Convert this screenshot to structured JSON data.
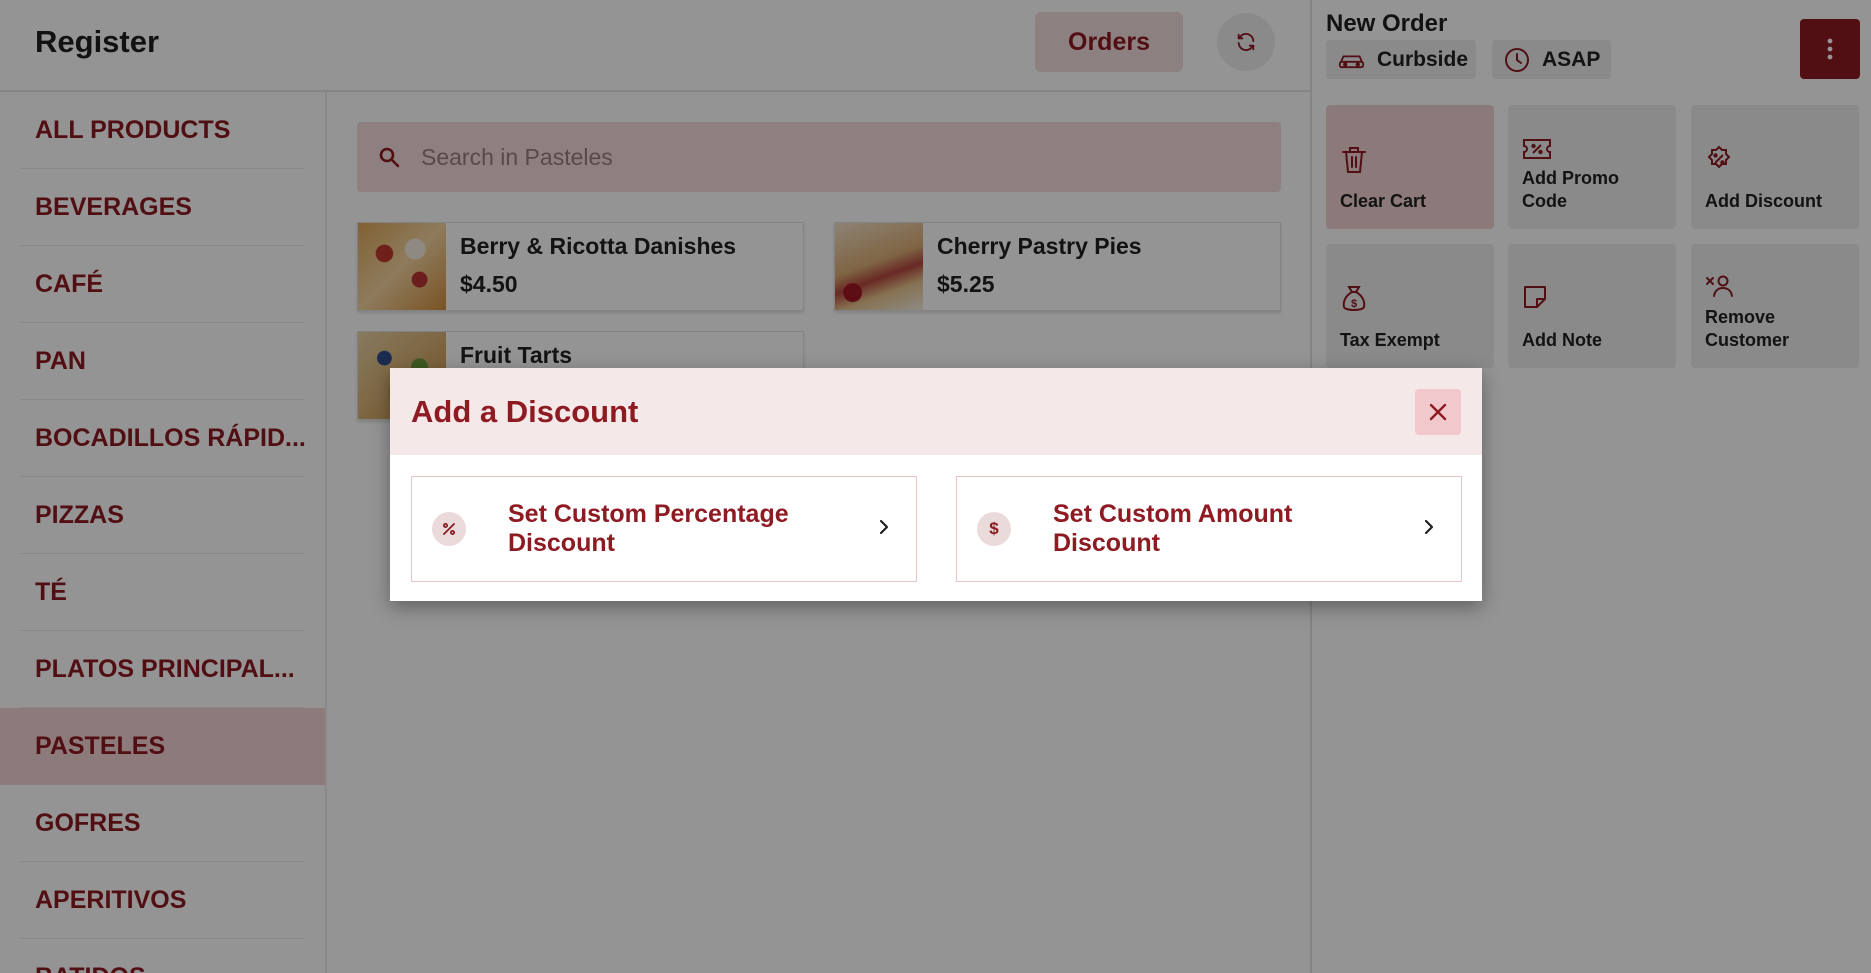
{
  "header": {
    "title": "Register",
    "orders_label": "Orders"
  },
  "categories": [
    {
      "label": "ALL PRODUCTS",
      "active": false
    },
    {
      "label": "BEVERAGES",
      "active": false
    },
    {
      "label": "CAFÉ",
      "active": false
    },
    {
      "label": "PAN",
      "active": false
    },
    {
      "label": "BOCADILLOS RÁPID...",
      "active": false
    },
    {
      "label": "PIZZAS",
      "active": false
    },
    {
      "label": "TÉ",
      "active": false
    },
    {
      "label": "PLATOS PRINCIPAL...",
      "active": false
    },
    {
      "label": "PASTELES",
      "active": true
    },
    {
      "label": "GOFRES",
      "active": false
    },
    {
      "label": "APERITIVOS",
      "active": false
    },
    {
      "label": "BATIDOS",
      "active": false
    }
  ],
  "search": {
    "placeholder": "Search in Pasteles",
    "value": ""
  },
  "products": [
    {
      "name": "Berry & Ricotta Danishes",
      "price": "$4.50"
    },
    {
      "name": "Cherry Pastry Pies",
      "price": "$5.25"
    },
    {
      "name": "Fruit Tarts",
      "price": ""
    }
  ],
  "order": {
    "title": "New Order",
    "type_label": "Curbside",
    "time_label": "ASAP"
  },
  "actions": [
    {
      "label": "Clear Cart",
      "icon": "trash-icon"
    },
    {
      "label": "Add Promo Code",
      "icon": "ticket-icon"
    },
    {
      "label": "Add Discount",
      "icon": "discount-badge-icon"
    },
    {
      "label": "Tax Exempt",
      "icon": "money-bag-icon"
    },
    {
      "label": "Add Note",
      "icon": "note-icon"
    },
    {
      "label": "Remove Customer",
      "icon": "remove-user-icon"
    }
  ],
  "modal": {
    "title": "Add a Discount",
    "options": [
      {
        "label": "Set Custom Percentage Discount",
        "icon": "percent-icon"
      },
      {
        "label": "Set Custom Amount Discount",
        "icon": "dollar-icon"
      }
    ]
  },
  "colors": {
    "brand": "#8e1a22",
    "brand_light": "#f1dcdc",
    "overlay": "rgba(0,0,0,0.42)"
  }
}
